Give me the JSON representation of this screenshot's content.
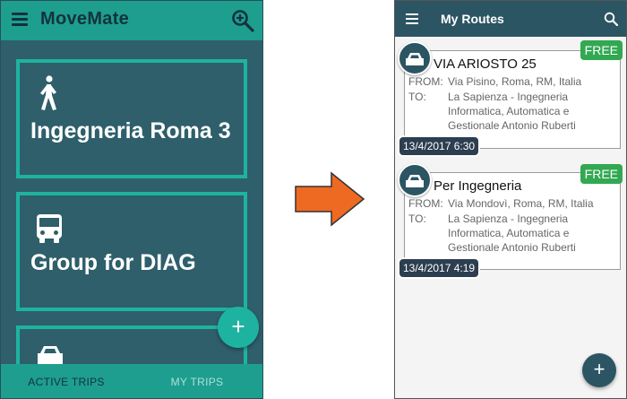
{
  "left_app": {
    "title": "MoveMate",
    "icons": {
      "menu": "menu-icon",
      "zoom": "zoom-in-icon",
      "add": "add-icon"
    },
    "cards": [
      {
        "label": "Ingegneria Roma 3",
        "icon": "walking-person-icon"
      },
      {
        "label": "Group for DIAG",
        "icon": "bus-icon"
      },
      {
        "label": "",
        "icon": "car-icon"
      }
    ],
    "fab_label": "+",
    "tabs": [
      {
        "label": "ACTIVE TRIPS",
        "active": true
      },
      {
        "label": "MY TRIPS",
        "active": false
      }
    ],
    "colors": {
      "appbar": "#1e9e8e",
      "background": "#2e5f6b",
      "card_border": "#1eb3a0"
    }
  },
  "arrow": {
    "icon": "right-arrow-icon",
    "color": "#ee6a22"
  },
  "right_app": {
    "title": "My Routes",
    "icons": {
      "menu": "menu-icon",
      "search": "search-icon",
      "add": "add-icon"
    },
    "from_label": "FROM:",
    "to_label": "TO:",
    "routes": [
      {
        "title": "VIA ARIOSTO 25",
        "badge": "FREE",
        "from": "Via Pisino, Roma, RM, Italia",
        "to": "La Sapienza - Ingegneria Informatica, Automatica e Gestionale Antonio Ruberti",
        "datetime": "13/4/2017 6:30"
      },
      {
        "title": "Per Ingegneria",
        "badge": "FREE",
        "from": "Via Mondovì, Roma, RM, Italia",
        "to": "La Sapienza - Ingegneria Informatica, Automatica e Gestionale Antonio Ruberti",
        "datetime": "13/4/2017 4:19"
      }
    ],
    "fab_label": "+",
    "colors": {
      "appbar": "#2c5563",
      "badge": "#32a852",
      "date_chip": "#2c3e50"
    }
  }
}
